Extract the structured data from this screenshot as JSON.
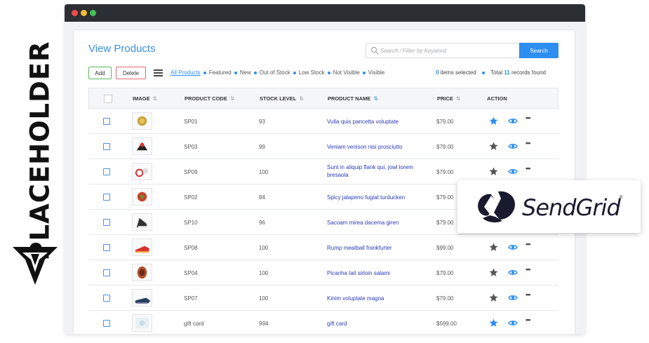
{
  "brand": {
    "placeholder_text": "PLACEHOLDER",
    "partner_name": "SendGrid",
    "partner_mark": "®"
  },
  "page": {
    "title": "View Products"
  },
  "search": {
    "placeholder": "Search / Filter by Keyword",
    "button_label": "Search"
  },
  "toolbar": {
    "add_label": "Add",
    "delete_label": "Delete"
  },
  "filters": [
    "All Products",
    "Featured",
    "New",
    "Out of Stock",
    "Low Stock",
    "Not Visible",
    "Visible"
  ],
  "selection": {
    "selected_count": "0",
    "selected_label": "items selected",
    "total_prefix": "Total",
    "total_count": "11",
    "total_suffix": "records found"
  },
  "table": {
    "headers": {
      "image": "IMAGE",
      "code": "PRODUCT CODE",
      "stock": "STOCK LEVEL",
      "name": "PRODUCT NAME",
      "price": "PRICE",
      "action": "ACTION"
    },
    "rows": [
      {
        "code": "SP01",
        "stock": "93",
        "name": "Vulla quis pancetta voluptate",
        "price": "$79.00",
        "featured": true
      },
      {
        "code": "SP03",
        "stock": "99",
        "name": "Veniam venison nisi prosciutto",
        "price": "$79.00",
        "featured": false
      },
      {
        "code": "SP09",
        "stock": "100",
        "name": "Sunt in aliquip flank qui, jowl lorem bresaola",
        "price": "$79.00",
        "featured": false
      },
      {
        "code": "SP02",
        "stock": "84",
        "name": "Spicy jalapeno fugiat turducken",
        "price": "$79.00",
        "featured": false
      },
      {
        "code": "SP10",
        "stock": "96",
        "name": "Sacoam mirea dacema giren",
        "price": "$79.00",
        "featured": false
      },
      {
        "code": "SP08",
        "stock": "100",
        "name": "Rump meatball frankfurter",
        "price": "$99.00",
        "featured": false
      },
      {
        "code": "SP04",
        "stock": "100",
        "name": "Picanha tail sirloin salami",
        "price": "$79.00",
        "featured": false
      },
      {
        "code": "SP07",
        "stock": "100",
        "name": "Kinim voluptate magna",
        "price": "$79.00",
        "featured": false
      },
      {
        "code": "gift card",
        "stock": "994",
        "name": "gift card",
        "price": "$599.00",
        "featured": true
      }
    ]
  },
  "colors": {
    "accent": "#2d8ef0",
    "link": "#2a3bb8",
    "titlebar": "#2b2e33"
  }
}
